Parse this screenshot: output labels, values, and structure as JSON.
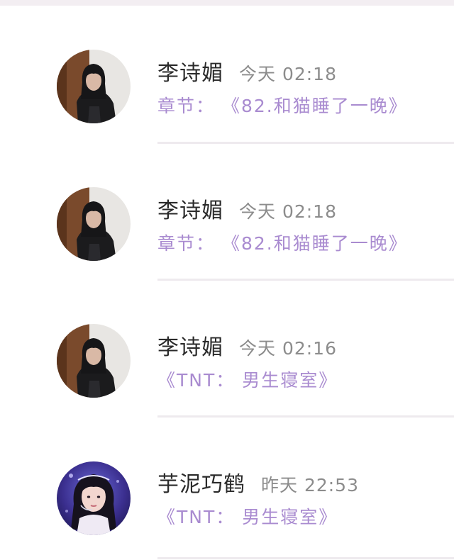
{
  "comments": [
    {
      "name": "李诗媚",
      "time": "今天 02:18",
      "content": "章节： 《82.和猫睡了一晚》",
      "avatar": "dark-haired-girl-portrait-icon"
    },
    {
      "name": "李诗媚",
      "time": "今天 02:18",
      "content": "章节： 《82.和猫睡了一晚》",
      "avatar": "dark-haired-girl-portrait-icon"
    },
    {
      "name": "李诗媚",
      "time": "今天 02:16",
      "content": "《TNT： 男生寝室》",
      "avatar": "dark-haired-girl-portrait-icon"
    },
    {
      "name": "芋泥巧鹤",
      "time": "昨天 22:53",
      "content": "《TNT： 男生寝室》",
      "avatar": "stage-performer-portrait-icon"
    }
  ],
  "colors": {
    "accent": "#a98bd0",
    "name": "#2a2a2a",
    "time": "#8c8c8c",
    "divider": "#eeeaee"
  }
}
